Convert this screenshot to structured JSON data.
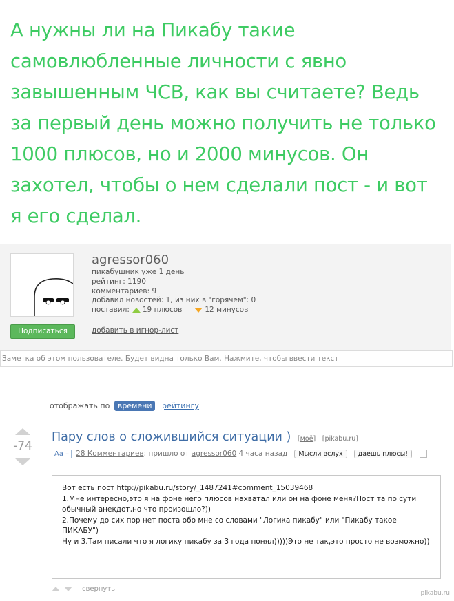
{
  "headline": "А нужны ли на Пикабу такие самовлюбленные личности с явно завышенным ЧСВ, как вы считаете? Ведь за первый день можно получить не только 1000 плюсов, но и 2000 минусов. Он захотел, чтобы о нем сделали пост - и вот я его сделал.",
  "profile": {
    "username": "agressor060",
    "age": "пикабушник уже 1 день",
    "rating": "рейтинг: 1190",
    "comments": "комментариев: 9",
    "news": "добавил новостей: 1, из них в \"горячем\": 0",
    "gave_prefix": "поставил:",
    "pluses": "19 плюсов",
    "minuses": "12 минусов",
    "subscribe_label": "Подписаться",
    "ignore_label": "добавить в игнор-лист",
    "note_placeholder": "Заметка об этом пользователе. Будет видна только Вам. Нажмите, чтобы ввести текст"
  },
  "sort": {
    "prefix": "отображать по",
    "active": "времени",
    "other": "рейтингу"
  },
  "post": {
    "rating": "-74",
    "title": "Пару слов о сложившийся ситуации )",
    "tag_mine": "моё",
    "tag_site": "[pikabu.ru]",
    "aa": "Aa –",
    "comments_link": "28 Комментариев",
    "posted_text": "; пришло от",
    "author": "agressor060",
    "time": "4 часа назад",
    "btn_think": "Мысли вслух",
    "btn_give": "даешь плюсы!",
    "body": [
      "Вот есть пост http://pikabu.ru/story/_1487241#comment_15039468",
      "1.Мне интересно,это я на фоне него плюсов нахватал или он на фоне меня?Пост та по сути обычный анекдот,но что произошло?))",
      "2.Почему до сих пор нет поста обо мне со словами \"Логика пикабу\" или \"Пикабу такое ПИКАБУ\")",
      "Ну и 3.Там писали что я логику пикабу за 3 года понял)))))Это не так,это просто не возможно))"
    ],
    "collapse_label": "свернуть"
  },
  "watermark": "pikabu.ru",
  "colors": {
    "headline": "#3ecb63",
    "subscribe": "#5cb85c",
    "plus": "#8fcc42",
    "minus": "#f5a623",
    "link": "#3f6da6"
  }
}
